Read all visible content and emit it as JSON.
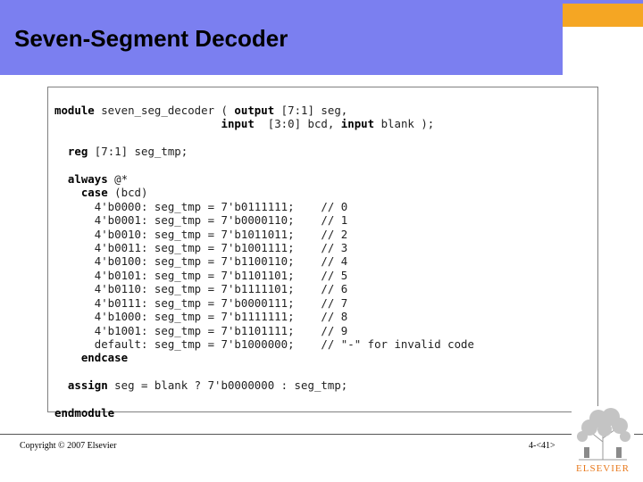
{
  "slide": {
    "title": "Seven-Segment Decoder",
    "footer_left": "Copyright © 2007 Elsevier",
    "footer_right": "4-<41>",
    "logo_text": "ELSEVIER"
  },
  "code_lines": [
    [
      {
        "t": "module",
        "k": true
      },
      {
        "t": " seven_seg_decoder ( "
      },
      {
        "t": "output",
        "k": true
      },
      {
        "t": " [7:1] seg,"
      }
    ],
    [
      {
        "t": "                         "
      },
      {
        "t": "input",
        "k": true
      },
      {
        "t": "  [3:0] bcd, "
      },
      {
        "t": "input",
        "k": true
      },
      {
        "t": " blank );"
      }
    ],
    [
      {
        "t": ""
      }
    ],
    [
      {
        "t": "  "
      },
      {
        "t": "reg",
        "k": true
      },
      {
        "t": " [7:1] seg_tmp;"
      }
    ],
    [
      {
        "t": ""
      }
    ],
    [
      {
        "t": "  "
      },
      {
        "t": "always",
        "k": true
      },
      {
        "t": " @*"
      }
    ],
    [
      {
        "t": "    "
      },
      {
        "t": "case",
        "k": true
      },
      {
        "t": " (bcd)"
      }
    ],
    [
      {
        "t": "      4'b0000: seg_tmp = 7'b0111111;    // 0"
      }
    ],
    [
      {
        "t": "      4'b0001: seg_tmp = 7'b0000110;    // 1"
      }
    ],
    [
      {
        "t": "      4'b0010: seg_tmp = 7'b1011011;    // 2"
      }
    ],
    [
      {
        "t": "      4'b0011: seg_tmp = 7'b1001111;    // 3"
      }
    ],
    [
      {
        "t": "      4'b0100: seg_tmp = 7'b1100110;    // 4"
      }
    ],
    [
      {
        "t": "      4'b0101: seg_tmp = 7'b1101101;    // 5"
      }
    ],
    [
      {
        "t": "      4'b0110: seg_tmp = 7'b1111101;    // 6"
      }
    ],
    [
      {
        "t": "      4'b0111: seg_tmp = 7'b0000111;    // 7"
      }
    ],
    [
      {
        "t": "      4'b1000: seg_tmp = 7'b1111111;    // 8"
      }
    ],
    [
      {
        "t": "      4'b1001: seg_tmp = 7'b1101111;    // 9"
      }
    ],
    [
      {
        "t": "      default: seg_tmp = 7'b1000000;    // \"-\" for invalid code"
      }
    ],
    [
      {
        "t": "    "
      },
      {
        "t": "endcase",
        "k": true
      }
    ],
    [
      {
        "t": ""
      }
    ],
    [
      {
        "t": "  "
      },
      {
        "t": "assign",
        "k": true
      },
      {
        "t": " seg = blank ? 7'b0000000 : seg_tmp;"
      }
    ],
    [
      {
        "t": ""
      }
    ],
    [
      {
        "t": "endmodule",
        "k": true
      }
    ]
  ]
}
